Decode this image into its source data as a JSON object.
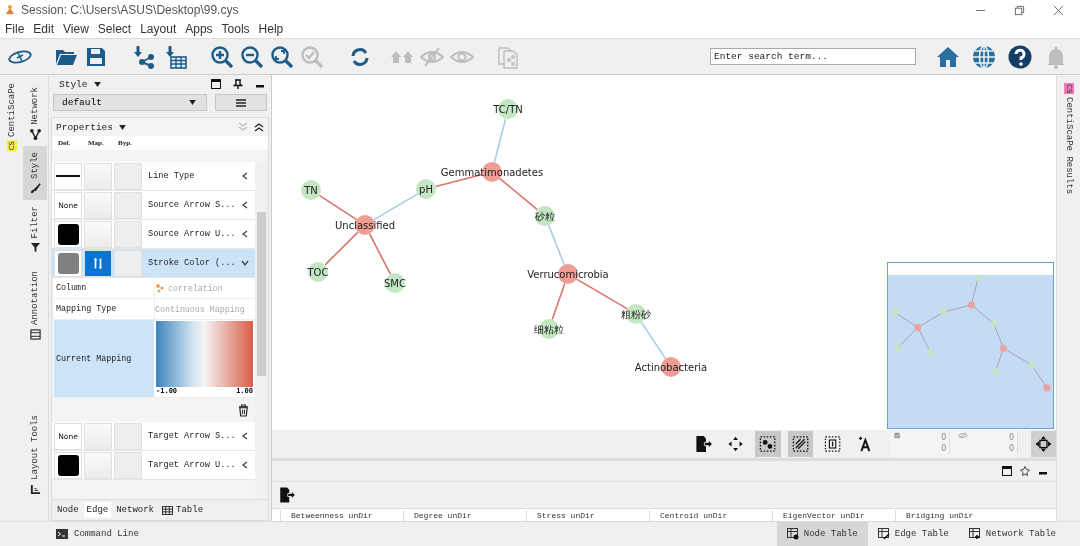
{
  "window": {
    "title": "Session: C:\\Users\\ASUS\\Desktop\\99.cys"
  },
  "menu": [
    "File",
    "Edit",
    "View",
    "Select",
    "Layout",
    "Apps",
    "Tools",
    "Help"
  ],
  "toolbar": [
    {
      "kind": "logo",
      "disabled": false
    },
    {
      "kind": "open",
      "disabled": false
    },
    {
      "kind": "save",
      "disabled": false
    },
    {
      "kind": "import-network",
      "disabled": false
    },
    {
      "kind": "import-table",
      "disabled": false
    },
    {
      "kind": "zoom-in",
      "disabled": false
    },
    {
      "kind": "zoom-out",
      "disabled": false
    },
    {
      "kind": "zoom-fit",
      "disabled": false
    },
    {
      "kind": "zoom-selected",
      "disabled": true
    },
    {
      "kind": "refresh",
      "disabled": false
    },
    {
      "kind": "houses",
      "disabled": true
    },
    {
      "kind": "hide",
      "disabled": true
    },
    {
      "kind": "show",
      "disabled": true
    },
    {
      "kind": "document",
      "disabled": true
    }
  ],
  "search": {
    "placeholder": "Enter search term..."
  },
  "toolbar_right": [
    {
      "kind": "home",
      "disabled": false
    },
    {
      "kind": "globe",
      "disabled": false
    },
    {
      "kind": "help",
      "disabled": false
    },
    {
      "kind": "bell",
      "disabled": true
    }
  ],
  "plugin_tab": {
    "label": "CentiScaPe",
    "badge": "CS"
  },
  "left_tabs": [
    {
      "label": "Network",
      "selected": false
    },
    {
      "label": "Style",
      "selected": true
    },
    {
      "label": "Filter",
      "selected": false
    },
    {
      "label": "Annotation",
      "selected": false
    },
    {
      "label": "Layout Tools",
      "selected": false
    }
  ],
  "style_panel": {
    "title": "Style",
    "style_name": "default",
    "section": "Properties",
    "columns": [
      "Def.",
      "Map.",
      "Byp."
    ],
    "rows": [
      {
        "name": "Line Type",
        "def": {
          "kind": "line"
        },
        "mapped": false,
        "selected": false,
        "expanded": false
      },
      {
        "name": "Source Arrow S...",
        "def": {
          "kind": "text",
          "text": "None"
        },
        "mapped": false,
        "selected": false,
        "expanded": false
      },
      {
        "name": "Source Arrow U...",
        "def": {
          "kind": "swatch",
          "color": "#000000"
        },
        "mapped": false,
        "selected": false,
        "expanded": false
      },
      {
        "name": "Stroke Color (...",
        "def": {
          "kind": "swatch",
          "color": "#808080"
        },
        "mapped": true,
        "selected": true,
        "expanded": true
      },
      {
        "name": "Target Arrow S...",
        "def": {
          "kind": "text",
          "text": "None"
        },
        "mapped": false,
        "selected": false,
        "expanded": false
      },
      {
        "name": "Target Arrow U...",
        "def": {
          "kind": "swatch",
          "color": "#000000"
        },
        "mapped": false,
        "selected": false,
        "expanded": false
      }
    ],
    "mapping": {
      "column_label": "Column",
      "column_value": "correlation",
      "type_label": "Mapping Type",
      "type_value": "Continuous Mapping",
      "current_label": "Current Mapping",
      "min": "-1.00",
      "max": "1.00"
    },
    "tabs": [
      {
        "label": "Node",
        "selected": false
      },
      {
        "label": "Edge",
        "selected": true
      },
      {
        "label": "Network",
        "selected": false
      },
      {
        "label": "Table",
        "selected": false
      }
    ]
  },
  "network": {
    "nodes": [
      {
        "label": "TC/TN",
        "color": "#c3e6c3"
      },
      {
        "label": "Gemmatimonadetes",
        "color": "#ef9d95"
      },
      {
        "label": "pH",
        "color": "#c3e6c3"
      },
      {
        "label": "TN",
        "color": "#c3e6c3"
      },
      {
        "label": "Unclassified",
        "color": "#ef9d95"
      },
      {
        "label": "TOC",
        "color": "#c3e6c3"
      },
      {
        "label": "SMC",
        "color": "#c3e6c3"
      },
      {
        "label": "砂粒",
        "color": "#c3e6c3"
      },
      {
        "label": "Verrucomicrobia",
        "color": "#ef9d95"
      },
      {
        "label": "细粘粒",
        "color": "#c3e6c3"
      },
      {
        "label": "粗粉砂",
        "color": "#c3e6c3"
      },
      {
        "label": "Actinobacteria",
        "color": "#ef9d95"
      }
    ],
    "edges": [
      {
        "color": "#a9cde6"
      },
      {
        "color": "#d9756b"
      },
      {
        "color": "#a9cde6"
      },
      {
        "color": "#d9756b"
      },
      {
        "color": "#d9756b"
      },
      {
        "color": "#d9756b"
      },
      {
        "color": "#d9756b"
      },
      {
        "color": "#a9cde6"
      },
      {
        "color": "#d9756b"
      },
      {
        "color": "#d9756b"
      },
      {
        "color": "#a9cde6"
      }
    ]
  },
  "canvas_toolbar": [
    {
      "kind": "export",
      "selected": false
    },
    {
      "kind": "pan",
      "selected": false
    },
    {
      "kind": "select-nodes",
      "selected": true
    },
    {
      "kind": "select-edges",
      "selected": true
    },
    {
      "kind": "annotation",
      "selected": false
    },
    {
      "kind": "text",
      "selected": false
    }
  ],
  "counts": {
    "selected_nodes": "0",
    "selected_edges": "0",
    "hidden_nodes": "0",
    "hidden_edges": "0"
  },
  "navigator": {
    "selected": true
  },
  "right_tab": {
    "label": "CentiScaPe Results",
    "badge": "CS"
  },
  "table_columns": [
    "Betweenness unDir",
    "Degree unDir",
    "Stress unDir",
    "Centroid unDir",
    "EigenVector unDir",
    "Bridging unDir"
  ],
  "status_bar": {
    "command": "Command Line",
    "tabs": [
      {
        "label": "Node Table",
        "selected": true
      },
      {
        "label": "Edge Table",
        "selected": false
      },
      {
        "label": "Network Table",
        "selected": false
      }
    ]
  }
}
